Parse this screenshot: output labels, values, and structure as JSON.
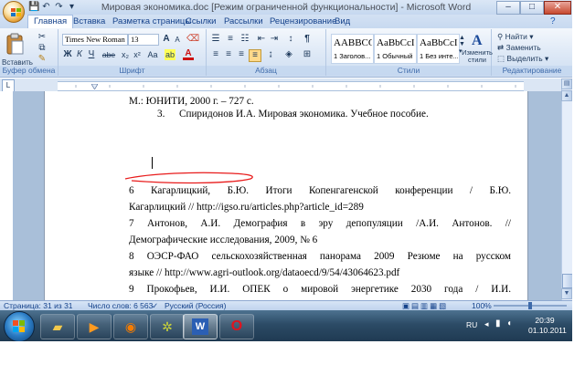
{
  "window": {
    "title": "Мировая экономика.doc [Режим ограниченной функциональности] - Microsoft Word",
    "buttons": {
      "minimize": "–",
      "maximize": "□",
      "close": "✕"
    }
  },
  "quick_access": {
    "save": "💾",
    "undo": "↶",
    "redo": "↷"
  },
  "tabs": [
    "Главная",
    "Вставка",
    "Разметка страницы",
    "Ссылки",
    "Рассылки",
    "Рецензирование",
    "Вид"
  ],
  "ribbon": {
    "clipboard": {
      "label": "Буфер обмена",
      "paste": "Вставить"
    },
    "font": {
      "label": "Шрифт",
      "name": "Times New Roman",
      "size": "13",
      "bold": "Ж",
      "italic": "К",
      "underline": "Ч",
      "strike": "abe",
      "sub": "x₂",
      "sup": "x²",
      "case": "Aa",
      "color": "A",
      "grow": "A",
      "shrink": "A"
    },
    "paragraph": {
      "label": "Абзац",
      "pilcrow": "¶"
    },
    "styles": {
      "label": "Стили",
      "items": [
        {
          "sample": "AABBCC",
          "name": "1 Заголов..."
        },
        {
          "sample": "AaBbCcI",
          "name": "1 Обычный"
        },
        {
          "sample": "AaBbCcI",
          "name": "1 Без инте..."
        }
      ],
      "change_line1": "Изменить",
      "change_line2": "стили"
    },
    "editing": {
      "label": "Редактирование",
      "find": "Найти",
      "replace": "Заменить",
      "select": "Выделить"
    }
  },
  "document": {
    "line1": "М.: ЮНИТИ, 2000 г. – 727 с.",
    "line2_num": "3.",
    "line2": "Спиридонов И.А. Мировая экономика. Учебное пособие.",
    "fn6_a": "6 Кагарлицкий, Б.Ю. Итоги Копенгагенской конференции / Б.Ю.",
    "fn6_b": "Кагарлицкий // http://igso.ru/articles.php?article_id=289",
    "fn7_a": "7 Антонов, А.И. Демография в эру депопуляции /А.И. Антонов. //",
    "fn7_b": "Демографические исследования, 2009, № 6",
    "fn8_a": "8 ОЭСР-ФАО сельскохозяйственная панорама 2009 Резюме на русском",
    "fn8_b": "языке // http://www.agri-outlook.org/dataoecd/9/54/43064623.pdf",
    "fn9_a": "9 Прокофьев, И.И. ОПЕК о мировой энергетике 2030 года / И.И."
  },
  "status": {
    "page": "Страница: 31 из 31",
    "words": "Число слов: 6 563",
    "lang": "Русский (Россия)",
    "zoom": "100%"
  },
  "taskbar": {
    "lang": "RU",
    "time": "20:39",
    "date": "01.10.2011"
  },
  "colors": {
    "accent": "#15428b",
    "annotation": "#e81b1b"
  }
}
